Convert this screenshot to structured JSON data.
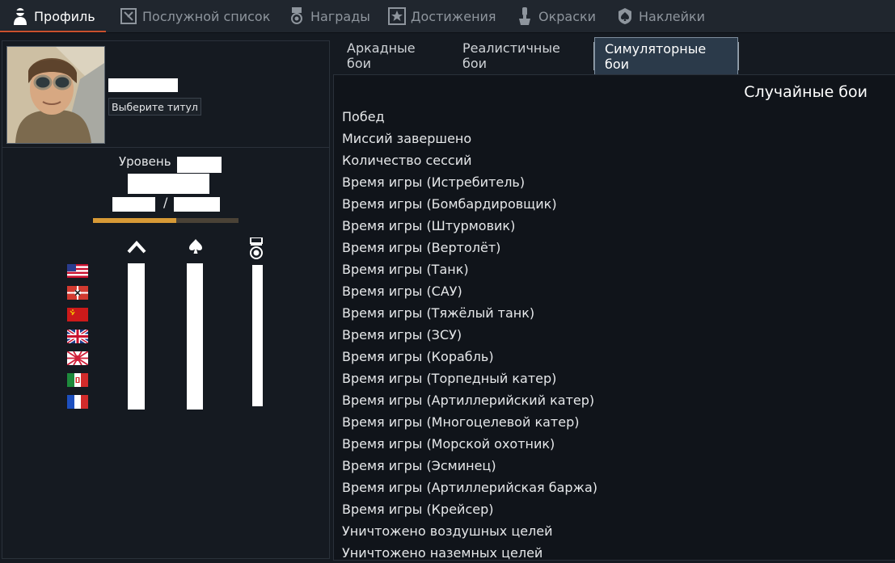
{
  "tabs": [
    {
      "label": "Профиль",
      "icon": "pilot-icon"
    },
    {
      "label": "Послужной список",
      "icon": "service-record-icon"
    },
    {
      "label": "Награды",
      "icon": "medal-icon"
    },
    {
      "label": "Достижения",
      "icon": "star-icon"
    },
    {
      "label": "Окраски",
      "icon": "paint-icon"
    },
    {
      "label": "Наклейки",
      "icon": "spade-badge-icon"
    }
  ],
  "profile": {
    "title_button": "Выберите титул",
    "level_label": "Уровень",
    "xp_slash": "/",
    "xp_progress": 0.57
  },
  "flags": [
    "usa-flag-icon",
    "germany-flag-icon",
    "ussr-flag-icon",
    "uk-flag-icon",
    "japan-flag-icon",
    "italy-flag-icon",
    "france-flag-icon"
  ],
  "stat_columns": [
    "rank-chevron-icon",
    "spade-icon",
    "medal-icon"
  ],
  "game_modes": [
    {
      "label": "Аркадные бои"
    },
    {
      "label": "Реалистичные бои"
    },
    {
      "label": "Симуляторные бои"
    }
  ],
  "stats": {
    "section_title": "Случайные бои",
    "rows": [
      "Побед",
      "Миссий завершено",
      "Количество сессий",
      "Время игры (Истребитель)",
      "Время игры (Бомбардировщик)",
      "Время игры (Штурмовик)",
      "Время игры (Вертолёт)",
      "Время игры (Танк)",
      "Время игры (САУ)",
      "Время игры (Тяжёлый танк)",
      "Время игры (ЗСУ)",
      "Время игры (Корабль)",
      "Время игры (Торпедный катер)",
      "Время игры (Артиллерийский катер)",
      "Время игры (Многоцелевой катер)",
      "Время игры (Морской охотник)",
      "Время игры (Эсминец)",
      "Время игры (Артиллерийская баржа)",
      "Время игры (Крейсер)",
      "Уничтожено воздушных целей",
      "Уничтожено наземных целей"
    ]
  }
}
